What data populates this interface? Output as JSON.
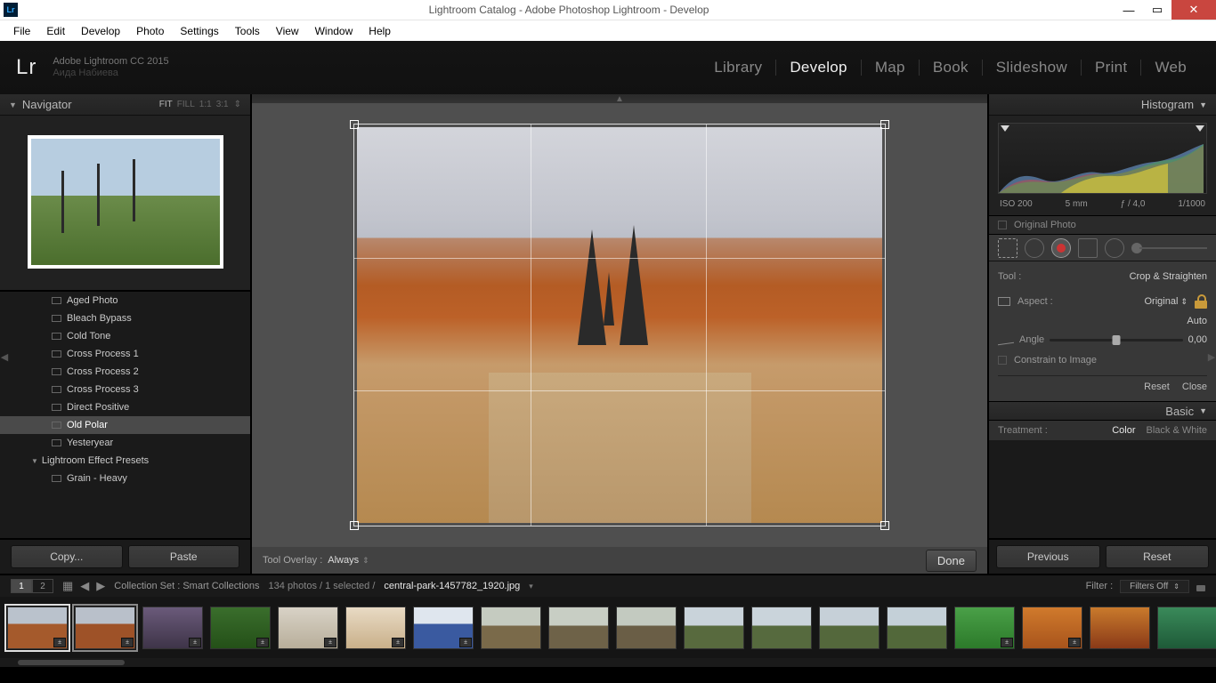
{
  "window": {
    "title": "Lightroom Catalog - Adobe Photoshop Lightroom - Develop",
    "app_badge": "Lr"
  },
  "menu": [
    "File",
    "Edit",
    "Develop",
    "Photo",
    "Settings",
    "Tools",
    "View",
    "Window",
    "Help"
  ],
  "identity": {
    "line1": "Adobe Lightroom CC 2015",
    "line2": "Аида Набиева"
  },
  "logo": "Lr",
  "modules": [
    "Library",
    "Develop",
    "Map",
    "Book",
    "Slideshow",
    "Print",
    "Web"
  ],
  "active_module": "Develop",
  "navigator": {
    "title": "Navigator",
    "zoom_options": [
      "FIT",
      "FILL",
      "1:1",
      "3:1"
    ],
    "zoom_selected": "FIT"
  },
  "presets": {
    "items": [
      "Aged Photo",
      "Bleach Bypass",
      "Cold Tone",
      "Cross Process 1",
      "Cross Process 2",
      "Cross Process 3",
      "Direct Positive",
      "Old Polar",
      "Yesteryear"
    ],
    "selected": "Old Polar",
    "section": "Lightroom Effect Presets",
    "extra": "Grain - Heavy"
  },
  "left_buttons": {
    "copy": "Copy...",
    "paste": "Paste"
  },
  "center": {
    "overlay_label": "Tool Overlay :",
    "overlay_value": "Always",
    "done": "Done"
  },
  "histogram": {
    "title": "Histogram",
    "iso": "ISO 200",
    "focal": "5 mm",
    "aperture": "ƒ / 4,0",
    "shutter": "1/1000",
    "original_photo": "Original Photo"
  },
  "tool_panel": {
    "tool_label": "Tool :",
    "tool_name": "Crop & Straighten",
    "aspect_label": "Aspect :",
    "aspect_value": "Original",
    "auto": "Auto",
    "angle_label": "Angle",
    "angle_value": "0,00",
    "constrain": "Constrain to Image",
    "reset": "Reset",
    "close": "Close"
  },
  "basic": {
    "title": "Basic",
    "treatment_label": "Treatment :",
    "color": "Color",
    "bw": "Black & White"
  },
  "right_buttons": {
    "previous": "Previous",
    "reset": "Reset"
  },
  "bottom": {
    "pages": [
      "1",
      "2"
    ],
    "collection": "Collection Set : Smart Collections",
    "count": "134 photos / 1 selected /",
    "filename": "central-park-1457782_1920.jpg",
    "filter_label": "Filter :",
    "filter_value": "Filters Off"
  }
}
